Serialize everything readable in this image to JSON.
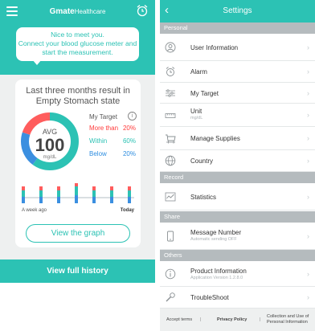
{
  "left": {
    "brand": "Gmate",
    "brand_suffix": "Healthcare",
    "bubble": [
      "Nice to meet you.",
      "Connect your blood glucose meter and",
      "start the measurement."
    ],
    "card_title": [
      "Last three months result in",
      "Empty Stomach state"
    ],
    "avg_label": "AVG",
    "avg_value": "100",
    "avg_unit": "mg/dL",
    "target_label": "My Target",
    "target_rows": [
      {
        "name": "More than",
        "pct": "20%",
        "color": "#ff3b3b"
      },
      {
        "name": "Within",
        "pct": "60%",
        "color": "#2cc2b4"
      },
      {
        "name": "Below",
        "pct": "20%",
        "color": "#2f8ee0"
      }
    ],
    "label_week": "A week ago",
    "label_today": "Today",
    "graph_button": "View the graph",
    "history_button": "View full history",
    "colors": {
      "accent": "#2cc2b4",
      "high": "#ff5d5d",
      "low": "#3b8fe0"
    }
  },
  "settings": {
    "title": "Settings",
    "sections": {
      "personal": "Personal",
      "record": "Record",
      "share": "Share",
      "others": "Others"
    },
    "items": {
      "user_info": "User Information",
      "alarm": "Alarm",
      "my_target": "My Target",
      "unit": "Unit",
      "unit_sub": "mg/dL",
      "supplies": "Manage Supplies",
      "country": "Country",
      "statistics": "Statistics",
      "message": "Message Number",
      "message_sub": "Automatic sending OFF",
      "product": "Product Information",
      "product_sub": "Application Version 1.2.8.0",
      "trouble": "TroubleShoot"
    },
    "footer": {
      "accept": "Accept terms",
      "sep": "|",
      "privacy": "Privacy Policy",
      "collection_1": "Collection and Use of",
      "collection_2": "Personal Information"
    }
  }
}
